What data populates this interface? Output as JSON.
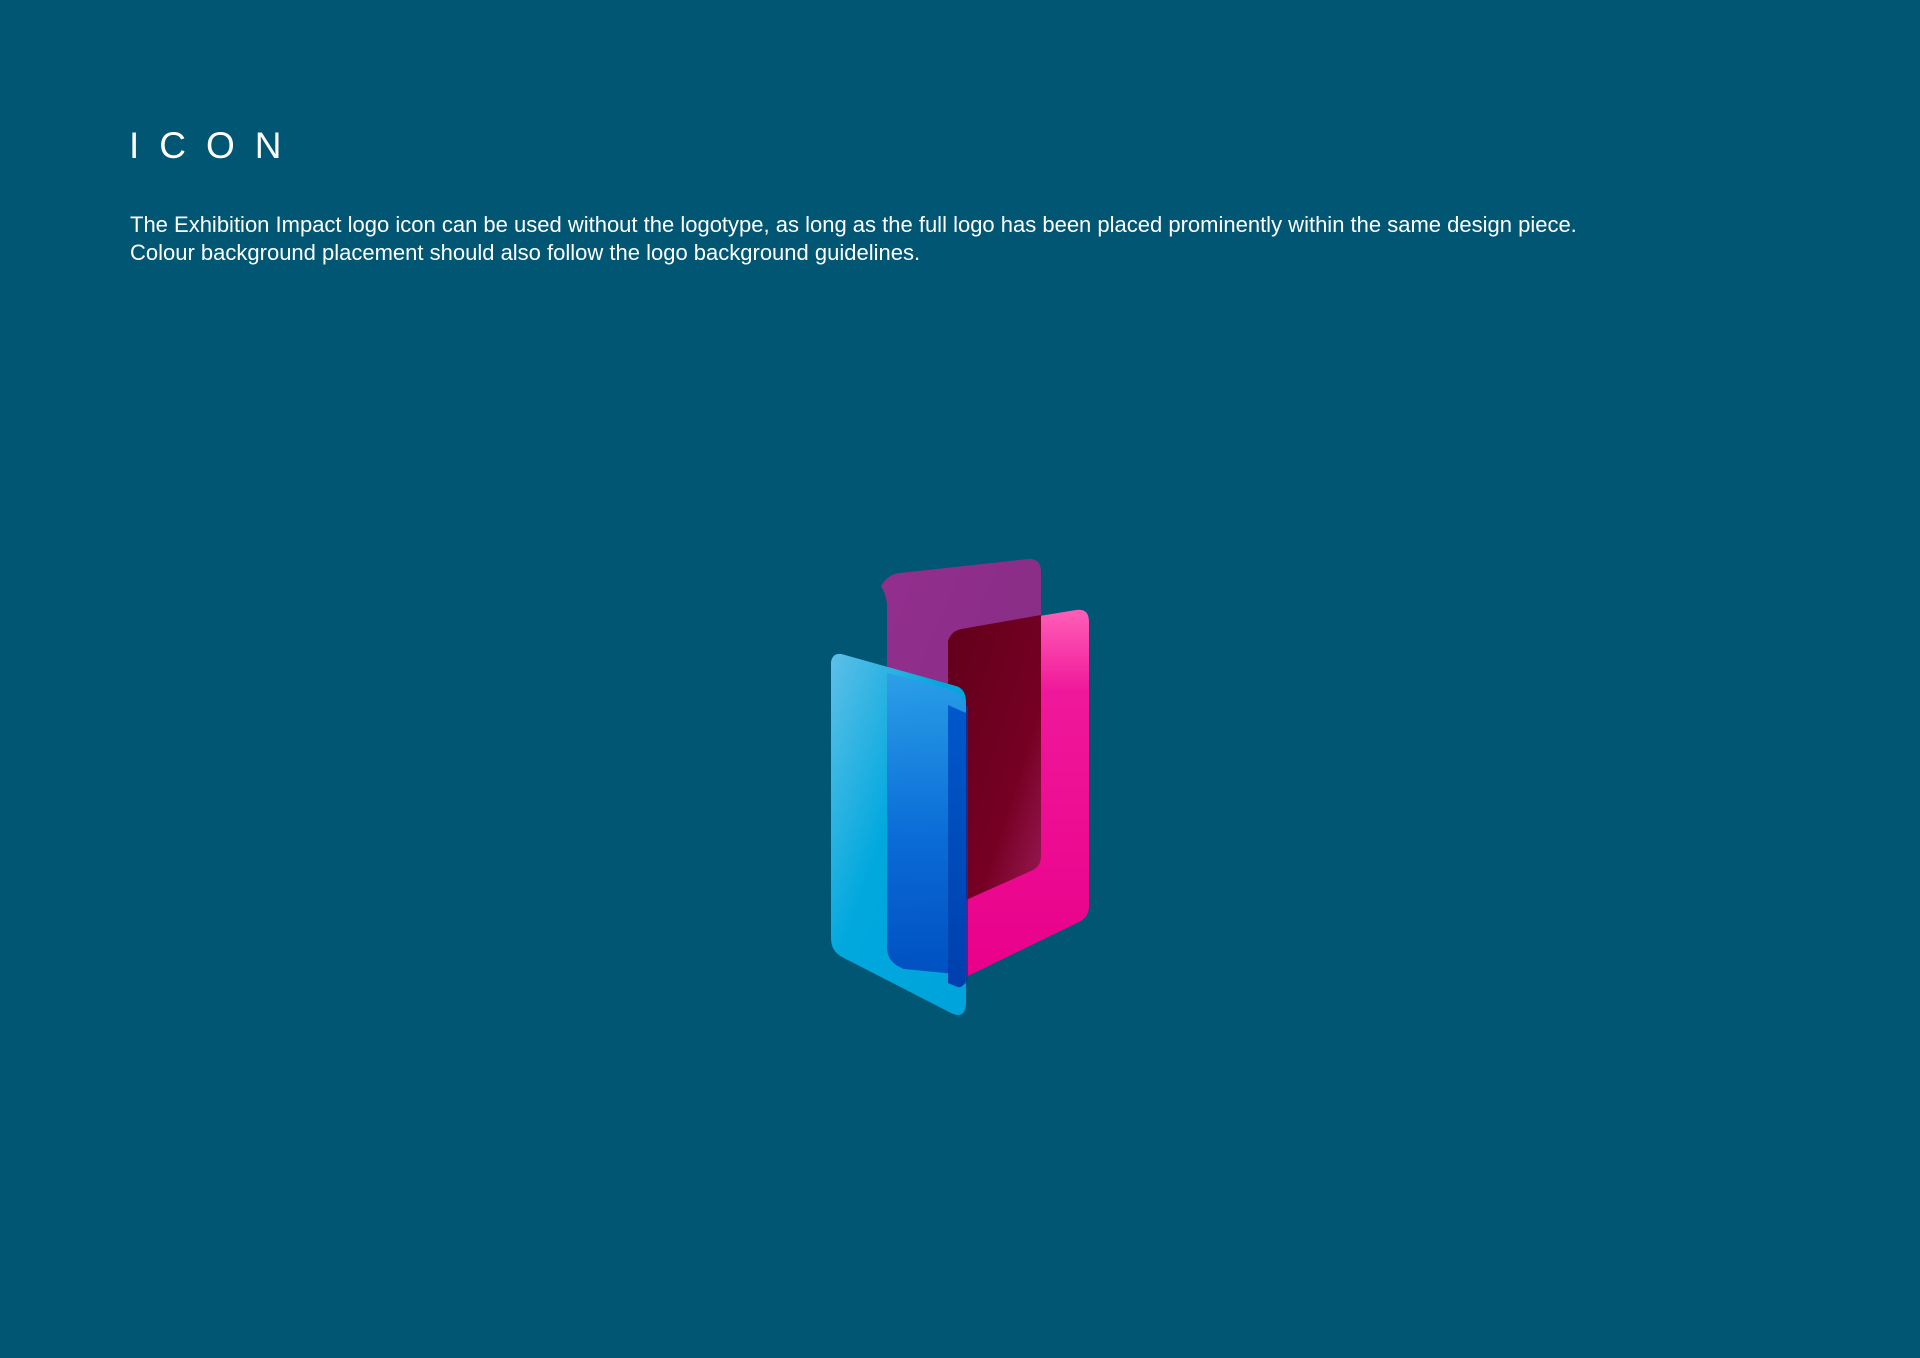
{
  "page": {
    "title": "ICON",
    "body_lines": [
      "The Exhibition Impact logo icon can be used without the logotype, as long as the full logo has been placed prominently within the same design piece.",
      "Colour background placement should also follow the logo background guidelines."
    ]
  },
  "logo": {
    "icon_name": "exhibition-impact-logo-icon",
    "colors": {
      "background": "#005673",
      "purple_panel": "#8f2f8a",
      "pink_panel": "#ec008c",
      "burgundy_overlap": "#650019",
      "blue_panel": "#0a5fd3",
      "cyan_panel": "#00a8de",
      "overlap_blue": "#0046b8"
    }
  }
}
